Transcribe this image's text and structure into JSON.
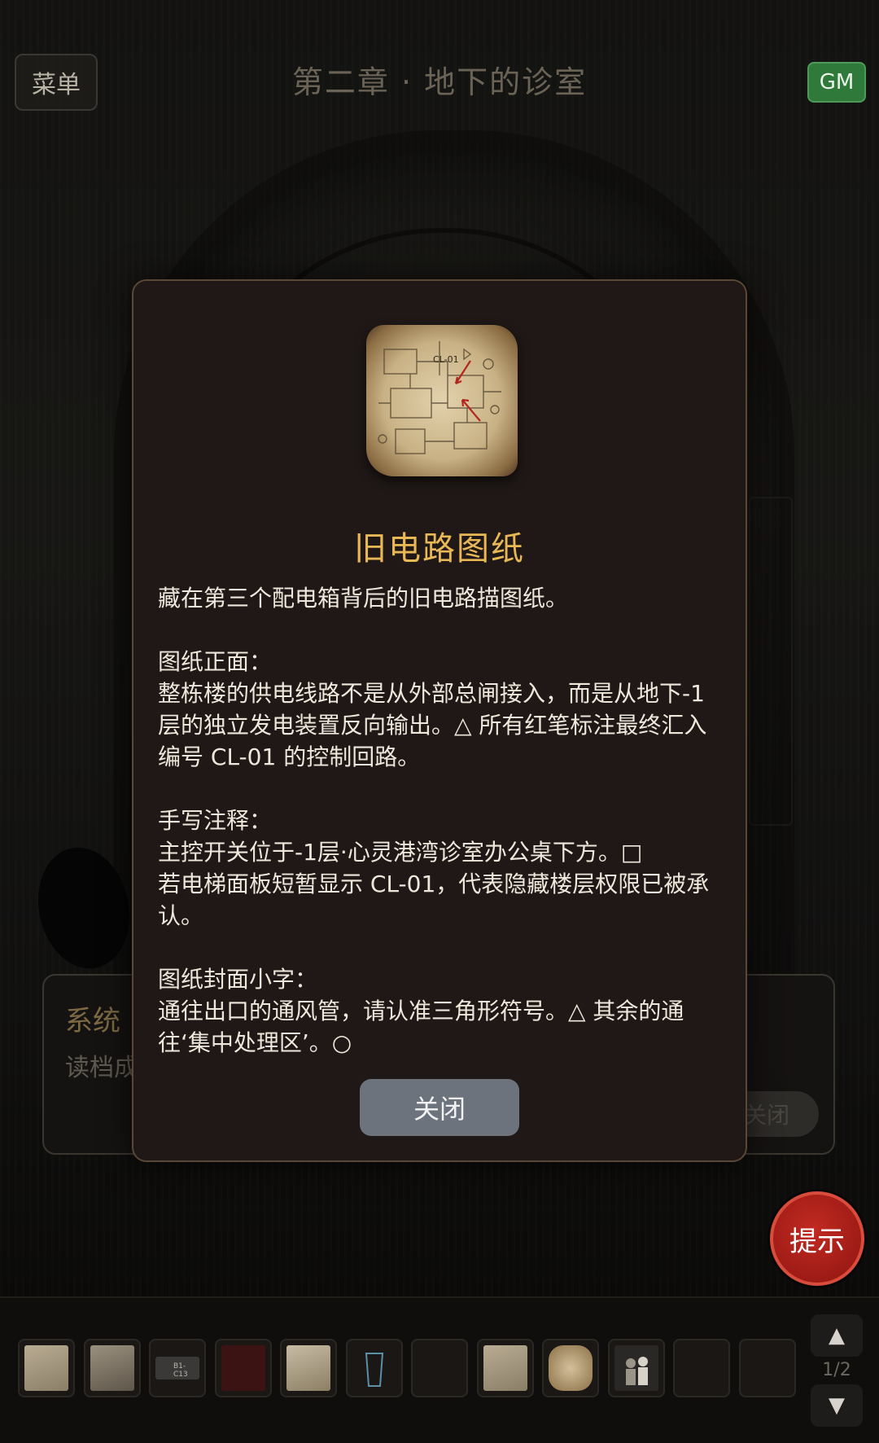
{
  "header": {
    "menu_label": "菜单",
    "chapter_title": "第二章 · 地下的诊室",
    "gm_label": "GM"
  },
  "system_panel": {
    "title": "系统",
    "text": "读档成功",
    "close_label": "关闭"
  },
  "modal": {
    "image_label": "CL-01",
    "item_name": "旧电路图纸",
    "description": "藏在第三个配电箱背后的旧电路描图纸。\n\n图纸正面：\n整栋楼的供电线路不是从外部总闸接入，而是从地下-1层的独立发电装置反向输出。△ 所有红笔标注最终汇入编号 CL-01 的控制回路。\n\n手写注释：\n主控开关位于-1层·心灵港湾诊室办公桌下方。□\n若电梯面板短暂显示 CL-01，代表隐藏楼层权限已被承认。\n\n图纸封面小字：\n通往出口的通风管，请认准三角形符号。△ 其余的通往‘集中处理区’。○",
    "close_label": "关闭"
  },
  "hint_label": "提示",
  "inventory": {
    "slots": [
      {
        "kind": "paper"
      },
      {
        "kind": "journal"
      },
      {
        "kind": "card",
        "label": "B1-C13"
      },
      {
        "kind": "book"
      },
      {
        "kind": "notes"
      },
      {
        "kind": "glass"
      },
      {
        "kind": "empty"
      },
      {
        "kind": "paper"
      },
      {
        "kind": "blueprint"
      },
      {
        "kind": "photo"
      },
      {
        "kind": "empty"
      },
      {
        "kind": "empty"
      }
    ],
    "page_text": "1/2",
    "up_icon": "▲",
    "down_icon": "▼"
  }
}
